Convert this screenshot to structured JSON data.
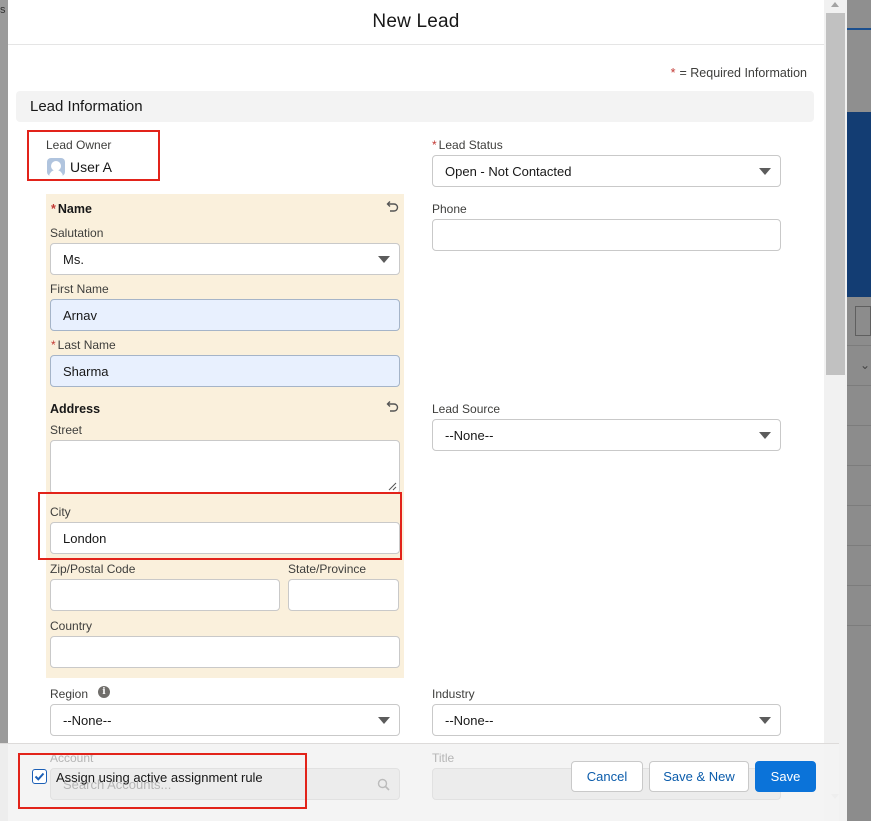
{
  "background": {
    "left_text": "s"
  },
  "modal": {
    "title": "New Lead",
    "required_info": "= Required Information",
    "section": "Lead Information"
  },
  "lead_owner": {
    "label": "Lead Owner",
    "value": "User A"
  },
  "lead_status": {
    "label": "Lead Status",
    "value": "Open - Not Contacted"
  },
  "name_group": {
    "label": "Name",
    "salutation": {
      "label": "Salutation",
      "value": "Ms."
    },
    "first_name": {
      "label": "First Name",
      "value": "Arnav"
    },
    "last_name": {
      "label": "Last Name",
      "value": "Sharma"
    }
  },
  "phone": {
    "label": "Phone",
    "value": ""
  },
  "address_group": {
    "label": "Address",
    "street": {
      "label": "Street",
      "value": ""
    },
    "city": {
      "label": "City",
      "value": "London"
    },
    "zip": {
      "label": "Zip/Postal Code",
      "value": ""
    },
    "state": {
      "label": "State/Province",
      "value": ""
    },
    "country": {
      "label": "Country",
      "value": ""
    }
  },
  "lead_source": {
    "label": "Lead Source",
    "value": "--None--"
  },
  "region": {
    "label": "Region",
    "value": "--None--"
  },
  "industry": {
    "label": "Industry",
    "value": "--None--"
  },
  "account": {
    "label": "Account",
    "placeholder": "Search Accounts..."
  },
  "title_field": {
    "label": "Title"
  },
  "footer": {
    "assign_rule_label": "Assign using active assignment rule",
    "assign_rule_checked": true,
    "cancel": "Cancel",
    "save_new": "Save & New",
    "save": "Save"
  },
  "colors": {
    "brand": "#0b73d9",
    "required": "#c23934",
    "group_bg": "#faf0dc",
    "highlight": "#e2231a"
  }
}
